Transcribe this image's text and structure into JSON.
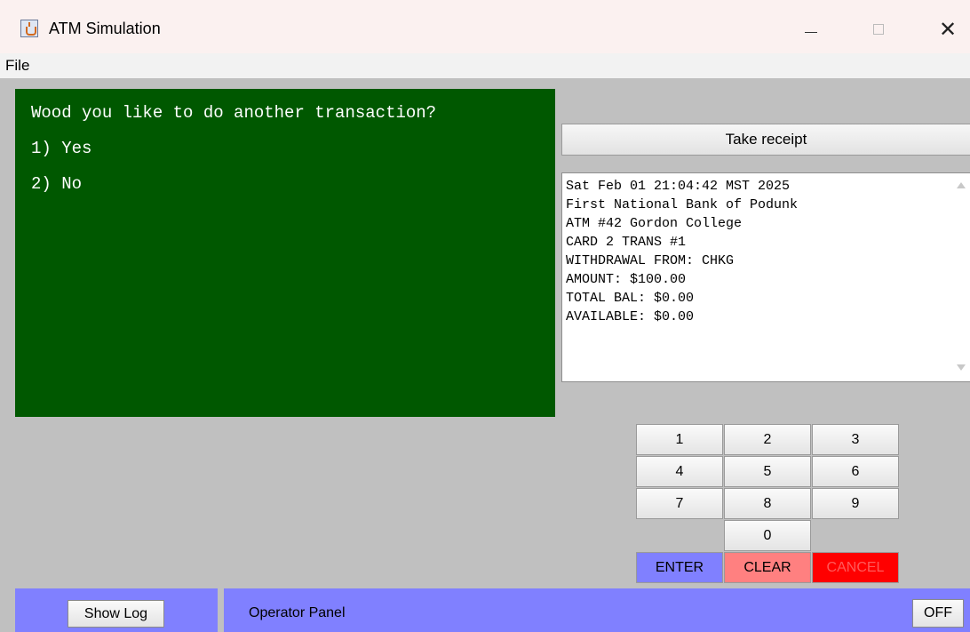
{
  "window": {
    "title": "ATM Simulation",
    "close_glyph": "✕"
  },
  "menu": {
    "file": "File"
  },
  "display": {
    "lines": [
      "Wood you like to do another transaction?",
      "1) Yes",
      "2) No"
    ],
    "background_color": "#005800"
  },
  "receipt": {
    "button_label": "Take receipt",
    "lines": [
      "Sat Feb 01 21:04:42 MST 2025",
      "First National Bank of Podunk",
      "ATM #42 Gordon College",
      "CARD 2 TRANS #1",
      "WITHDRAWAL FROM: CHKG",
      "AMOUNT: $100.00",
      "TOTAL BAL: $0.00",
      "AVAILABLE: $0.00"
    ]
  },
  "keypad": {
    "digits": [
      "1",
      "2",
      "3",
      "4",
      "5",
      "6",
      "7",
      "8",
      "9",
      "0"
    ],
    "enter": "ENTER",
    "clear": "CLEAR",
    "cancel": "CANCEL",
    "enter_color": "#8080ff",
    "clear_color": "#ff8080",
    "cancel_color": "#ff0000"
  },
  "operator": {
    "show_log": "Show Log",
    "label": "Operator Panel",
    "off": "OFF",
    "panel_color": "#8080ff"
  }
}
